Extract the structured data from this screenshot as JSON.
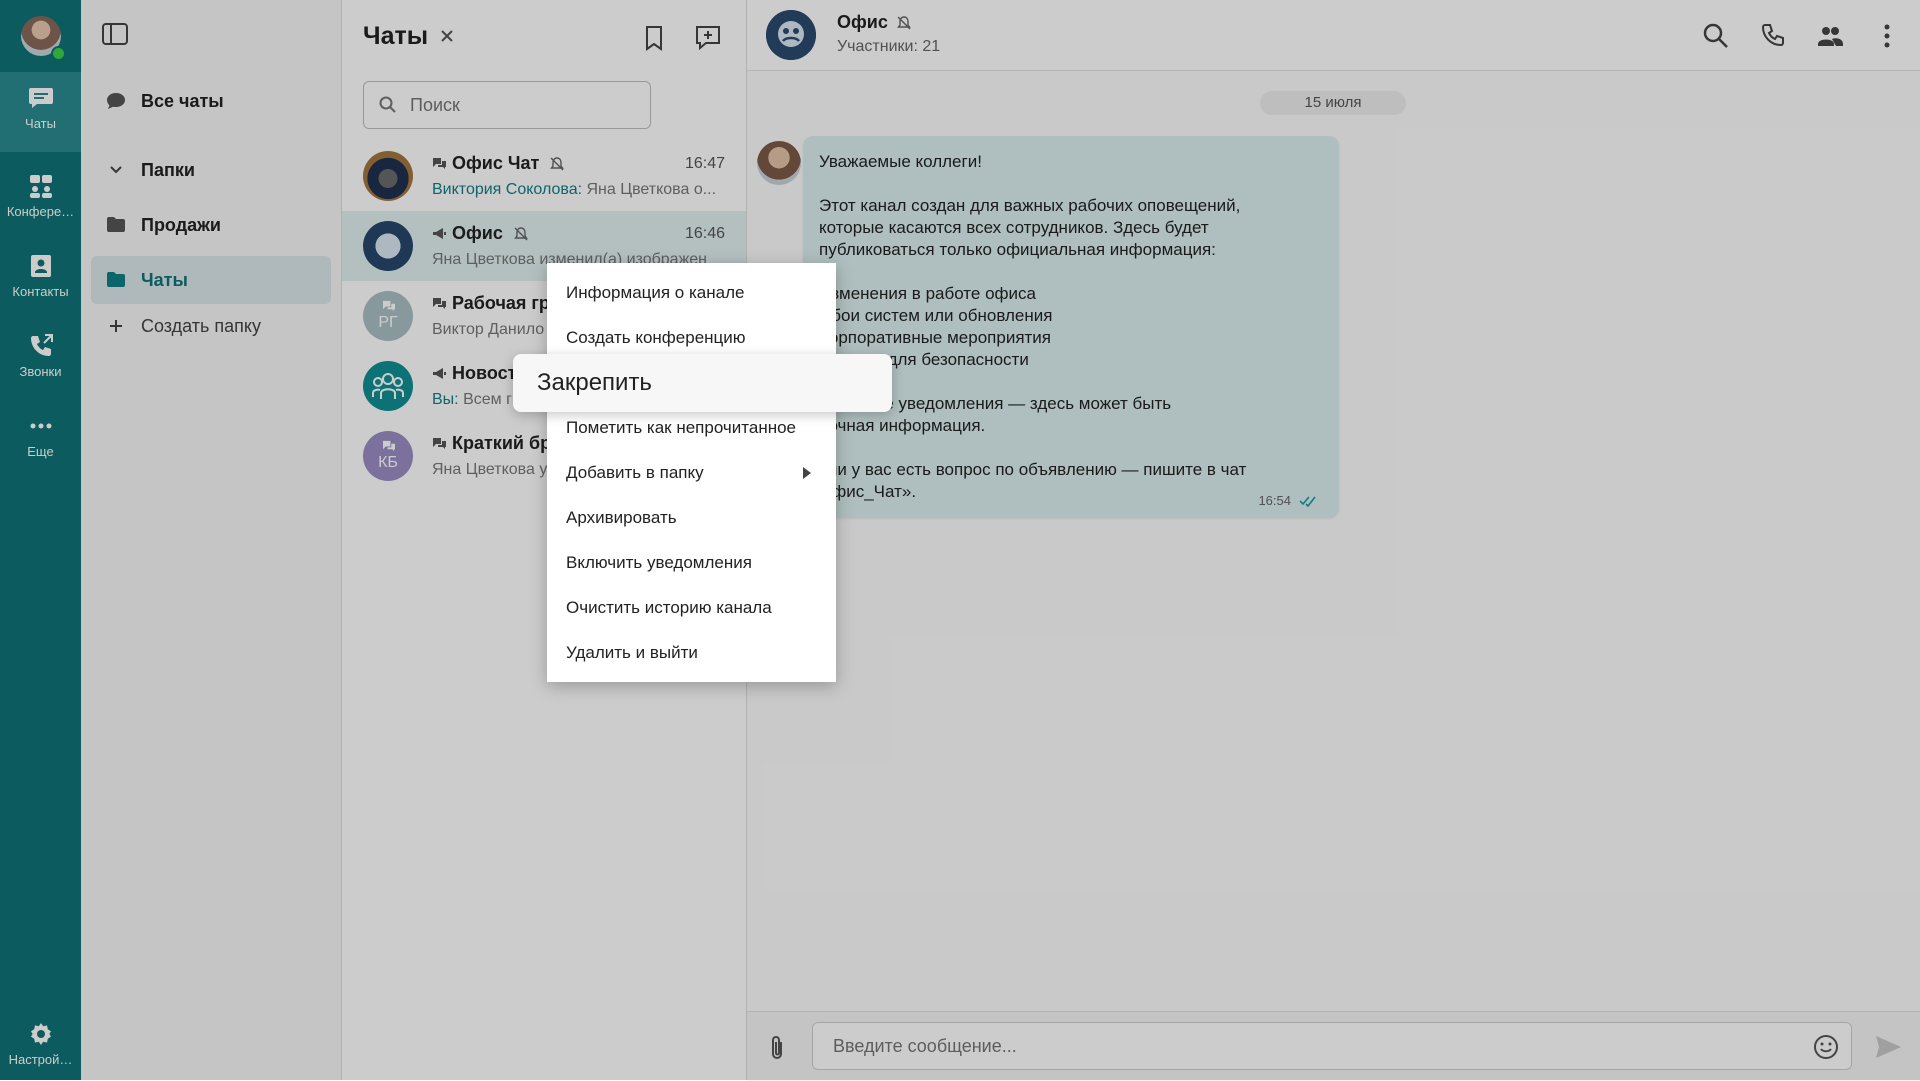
{
  "rail": {
    "items": [
      {
        "label": "Чаты",
        "icon": "chat-bubble-icon",
        "active": true
      },
      {
        "label": "Конфере…",
        "icon": "conference-icon",
        "active": false
      },
      {
        "label": "Контакты",
        "icon": "contacts-icon",
        "active": false
      },
      {
        "label": "Звонки",
        "icon": "calls-icon",
        "active": false
      },
      {
        "label": "Еще",
        "icon": "more-horizontal-icon",
        "active": false
      }
    ],
    "settings_label": "Настрой…"
  },
  "folders": {
    "all_chats": "Все чаты",
    "folders_header": "Папки",
    "items": [
      {
        "label": "Продажи",
        "active": false
      },
      {
        "label": "Чаты",
        "active": true
      }
    ],
    "create_folder": "Создать папку"
  },
  "chatlist": {
    "title": "Чаты",
    "search_placeholder": "Поиск",
    "chats": [
      {
        "name": "Офис Чат",
        "type": "group",
        "muted": true,
        "time": "16:47",
        "sender": "Виктория Соколова:",
        "preview": "Яна Цветкова о...",
        "initials": ""
      },
      {
        "name": "Офис",
        "type": "channel",
        "muted": true,
        "time": "16:46",
        "sender": "",
        "preview": "Яна Цветкова изменил(а) изображен",
        "initials": ""
      },
      {
        "name": "Рабочая гр",
        "type": "group",
        "muted": false,
        "time": "",
        "sender": "",
        "preview": "Виктор Данило",
        "initials": "РГ"
      },
      {
        "name": "Новост",
        "type": "channel",
        "muted": false,
        "time": "",
        "sender": "Вы:",
        "preview": "Всем г",
        "initials": ""
      },
      {
        "name": "Краткий бр",
        "type": "group",
        "muted": false,
        "time": "",
        "sender": "",
        "preview": "Яна Цветкова у",
        "initials": "КБ"
      }
    ]
  },
  "chat": {
    "title": "Офис",
    "subtitle": "Участники: 21",
    "date": "15 июля",
    "message": {
      "lines": [
        "Уважаемые коллеги!",
        "",
        "Этот канал создан для важных рабочих оповещений,",
        "которые касаются всех сотрудников. Здесь будет",
        "публиковаться только официальная информация:",
        "",
        "Изменения в работе офиса",
        "Сбои систем или обновления",
        "Корпоративные мероприятия",
        "приятия для безопасности",
        "",
        "ключайте уведомления — здесь может быть",
        "рочная информация.",
        "",
        "сли у вас есть вопрос по объявлению — пишите в чат",
        "Офис_Чат»."
      ],
      "time": "16:54"
    },
    "input_placeholder": "Введите сообщение..."
  },
  "context_menu": {
    "items": [
      "Информация о канале",
      "Создать конференцию",
      "",
      "Пометить как непрочитанное",
      "Добавить в папку",
      "Архивировать",
      "Включить уведомления",
      "Очистить историю канала",
      "Удалить и выйти"
    ],
    "dragged_item": "Закрепить"
  },
  "colors": {
    "rail": "#0f7276",
    "accent": "#0f7f86",
    "bubble": "#dbeeee",
    "selected_row": "#e2eff1"
  }
}
